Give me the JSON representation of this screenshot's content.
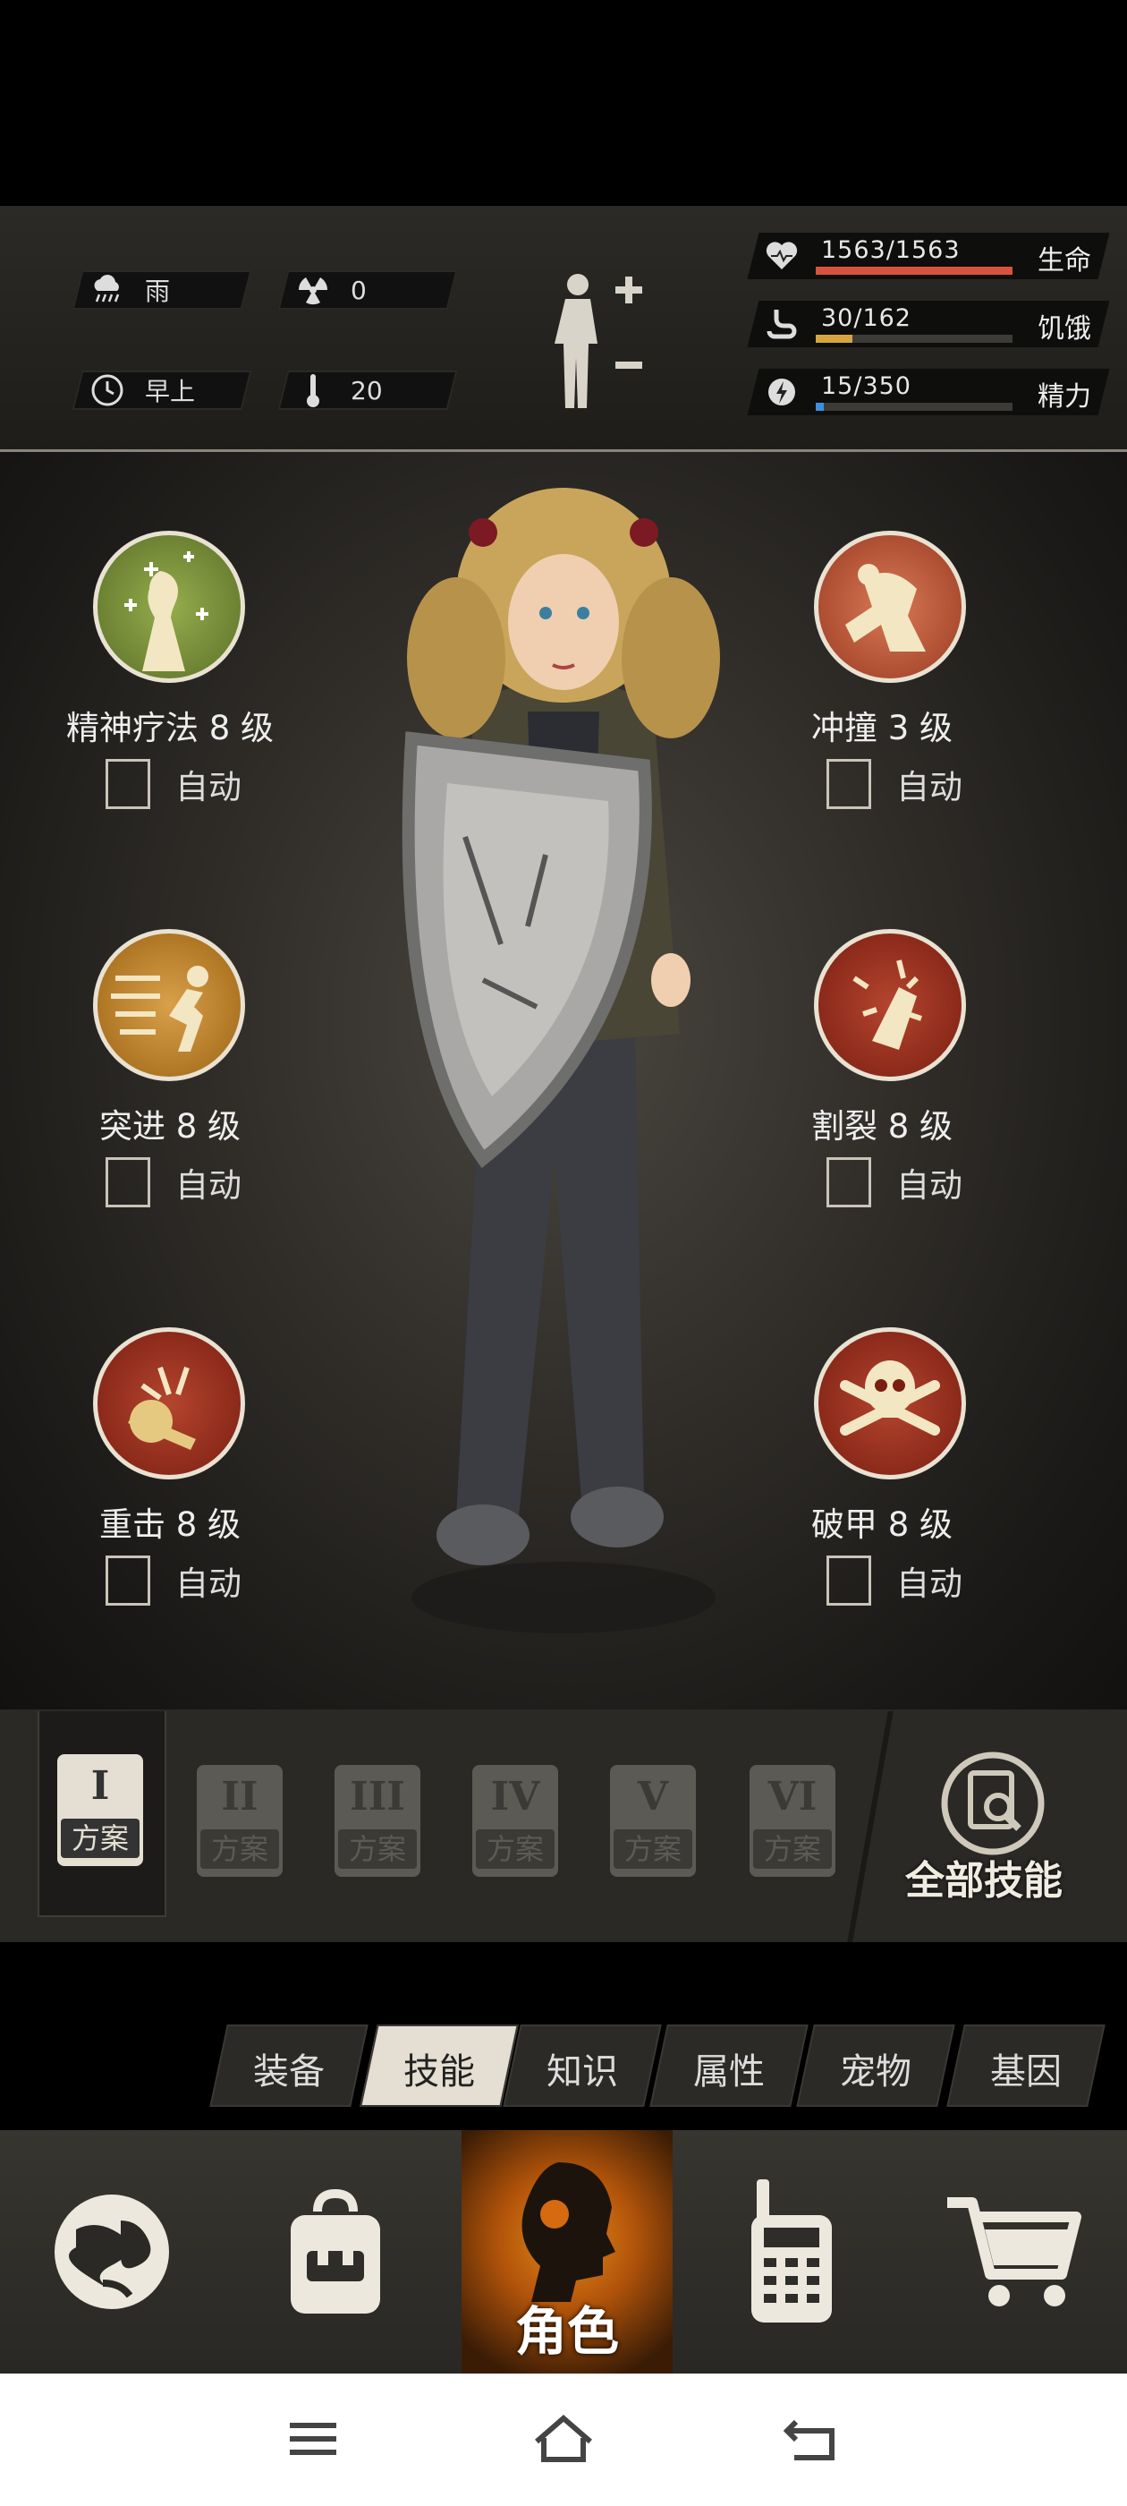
{
  "status": {
    "weather": "雨",
    "radiation": "0",
    "time_of_day": "早上",
    "temperature": "20",
    "bars": [
      {
        "label": "生命",
        "value": "1563/1563",
        "fill": 1.0,
        "color": "#d9523e",
        "icon": "heart-icon"
      },
      {
        "label": "饥饿",
        "value": "30/162",
        "fill": 0.185,
        "color": "#d7a540",
        "icon": "stomach-icon"
      },
      {
        "label": "精力",
        "value": "15/350",
        "fill": 0.043,
        "color": "#3c8fe0",
        "icon": "energy-icon"
      }
    ]
  },
  "skills": [
    {
      "name": "精神疗法 8 级",
      "auto": "自动",
      "icon": "mind-therapy-icon",
      "checked": false
    },
    {
      "name": "冲撞 3 级",
      "auto": "自动",
      "icon": "charge-icon",
      "checked": false
    },
    {
      "name": "突进 8 级",
      "auto": "自动",
      "icon": "dash-icon",
      "checked": false
    },
    {
      "name": "割裂 8 级",
      "auto": "自动",
      "icon": "rend-icon",
      "checked": false
    },
    {
      "name": "重击 8 级",
      "auto": "自动",
      "icon": "smash-icon",
      "checked": false
    },
    {
      "name": "破甲 8 级",
      "auto": "自动",
      "icon": "armor-break-icon",
      "checked": false
    }
  ],
  "plans": [
    {
      "num": "I",
      "label": "方案",
      "active": true
    },
    {
      "num": "II",
      "label": "方案",
      "active": false
    },
    {
      "num": "III",
      "label": "方案",
      "active": false
    },
    {
      "num": "IV",
      "label": "方案",
      "active": false
    },
    {
      "num": "V",
      "label": "方案",
      "active": false
    },
    {
      "num": "VI",
      "label": "方案",
      "active": false
    }
  ],
  "all_skills_label": "全部技能",
  "tabs": [
    "装备",
    "技能",
    "知识",
    "属性",
    "宠物",
    "基因"
  ],
  "active_tab": "技能",
  "nav": {
    "items": [
      "globe-icon",
      "backpack-icon",
      "character-icon",
      "walkie-talkie-icon",
      "cart-icon"
    ],
    "role_label": "角色"
  },
  "colors": {
    "accent": "#e58a1a",
    "panel": "#2a2926"
  }
}
